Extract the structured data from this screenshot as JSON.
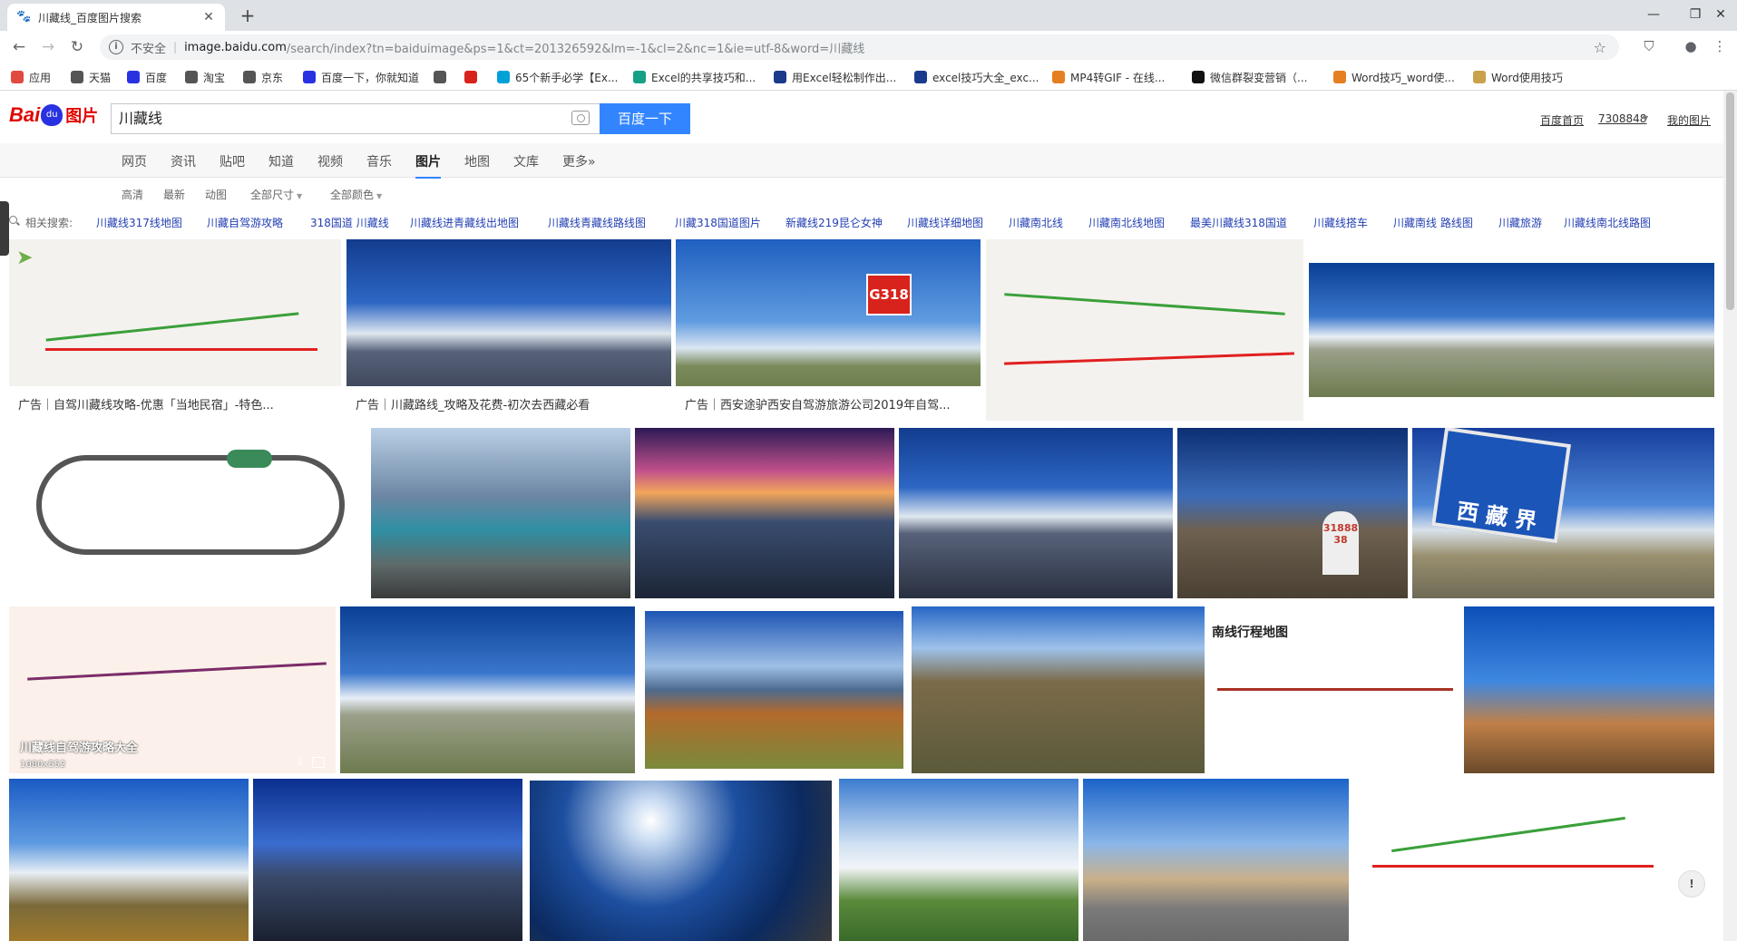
{
  "browser": {
    "tab_title": "川藏线_百度图片搜索",
    "new_tab": "+",
    "insecure_label": "不安全",
    "url_host": "image.baidu.com",
    "url_path": "/search/index?tn=baiduimage&ps=1&ct=201326592&lm=-1&cl=2&nc=1&ie=utf-8&word=川藏线"
  },
  "bookmarks": [
    {
      "label": "应用",
      "icon": "apps-icon",
      "color": "#e04a3f"
    },
    {
      "label": "天猫",
      "icon": "globe-icon",
      "color": "#555555"
    },
    {
      "label": "百度",
      "icon": "baidu-paw-icon",
      "color": "#2932e1"
    },
    {
      "label": "淘宝",
      "icon": "globe-icon",
      "color": "#555555"
    },
    {
      "label": "京东",
      "icon": "globe-icon",
      "color": "#555555"
    },
    {
      "label": "百度一下，你就知道",
      "icon": "baidu-paw-icon",
      "color": "#2932e1"
    },
    {
      "label": "",
      "icon": "globe-icon",
      "color": "#555555"
    },
    {
      "label": "",
      "icon": "c-icon",
      "color": "#d8231c"
    },
    {
      "label": "65个新手必学【Ex...",
      "icon": "bilibili-icon",
      "color": "#00a1d6"
    },
    {
      "label": "Excel的共享技巧和...",
      "icon": "sogou-icon",
      "color": "#16a085"
    },
    {
      "label": "用Excel轻松制作出...",
      "icon": "flag-icon",
      "color": "#1a3a8c"
    },
    {
      "label": "excel技巧大全_exc...",
      "icon": "flag-icon",
      "color": "#1a3a8c"
    },
    {
      "label": "MP4转GIF - 在线...",
      "icon": "swirl-icon",
      "color": "#e67e22"
    },
    {
      "label": "微信群裂变营销（...",
      "icon": "m-icon",
      "color": "#111111"
    },
    {
      "label": "Word技巧_word使...",
      "icon": "wps-icon",
      "color": "#e67e22"
    },
    {
      "label": "Word使用技巧",
      "icon": "tools-icon",
      "color": "#caa24c"
    }
  ],
  "header": {
    "logo_bai": "Bai",
    "logo_du": "du",
    "logo_tupian": "图片",
    "query": "川藏线",
    "search_button": "百度一下",
    "link_home": "百度首页",
    "link_user": "7308848",
    "link_my": "我的图片"
  },
  "nav_tabs": [
    "网页",
    "资讯",
    "贴吧",
    "知道",
    "视频",
    "音乐",
    "图片",
    "地图",
    "文库",
    "更多»"
  ],
  "active_tab": "图片",
  "filters": [
    "高清",
    "最新",
    "动图",
    "全部尺寸",
    "全部颜色"
  ],
  "related": {
    "label": "相关搜索:",
    "items": [
      "川藏线317线地图",
      "川藏自驾游攻略",
      "318国道 川藏线",
      "川藏线进青藏线出地图",
      "川藏线青藏线路线图",
      "川藏318国道图片",
      "新藏线219昆仑女神",
      "川藏线详细地图",
      "川藏南北线",
      "川藏南北线地图",
      "最美川藏线318国道",
      "川藏线搭车",
      "川藏南线 路线图",
      "川藏旅游",
      "川藏线南北线路图"
    ]
  },
  "ads": [
    "广告｜自驾川藏线攻略-优惠「当地民宿」-特色...",
    "广告｜川藏路线_攻略及花费-初次去西藏必看",
    "广告｜西安途驴西安自驾游旅游公司2019年自驾..."
  ],
  "overlay": {
    "title": "川藏线自驾游攻略大全",
    "size": "1080x552"
  },
  "map_title": "南线行程地图",
  "sign_text": "G318",
  "marker_text": "3188838",
  "tibet_sign": "西 藏 界"
}
